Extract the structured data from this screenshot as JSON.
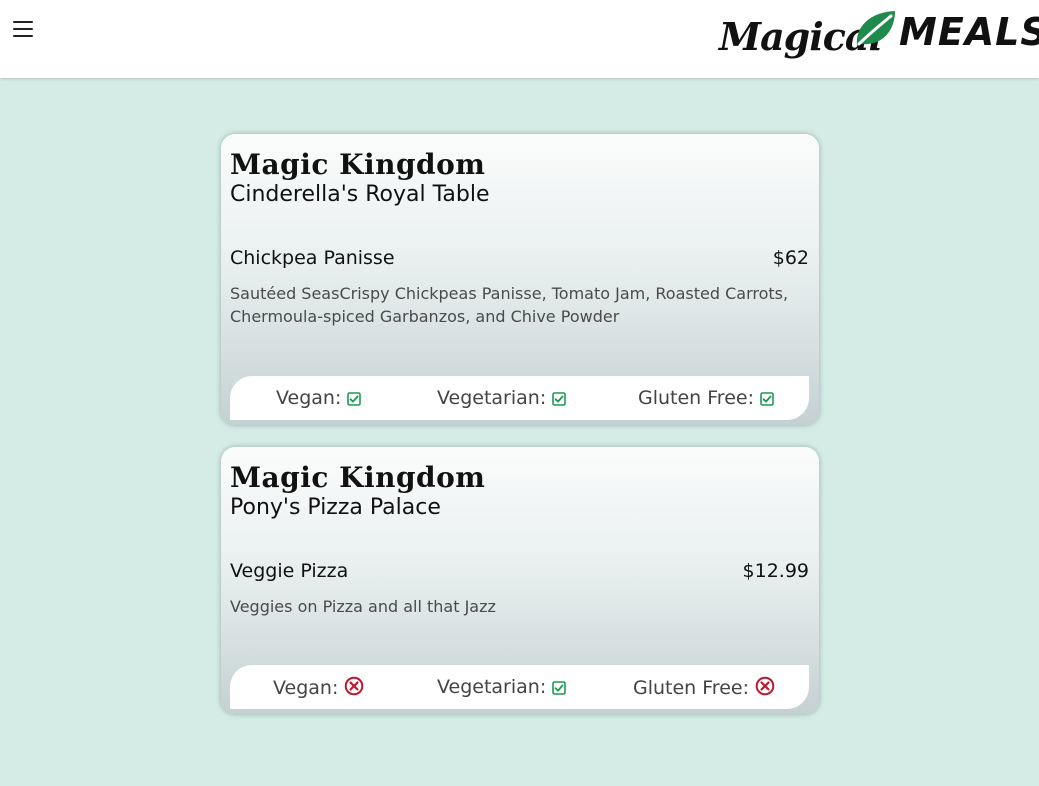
{
  "brand": {
    "logo_word_1": "Magical",
    "logo_word_2": "MEALS",
    "leaf_color": "#1f8a4c"
  },
  "colors": {
    "background": "#d5ece6",
    "check_color": "#1a9a52",
    "cross_color": "#c0162f"
  },
  "menu_icon": "hamburger-menu-icon",
  "cards": [
    {
      "park": "Magic Kingdom",
      "restaurant": "Cinderella's Royal Table",
      "dish": "Chickpea Panisse",
      "price": "$62",
      "description": "Sautéed SeasCrispy Chickpeas Panisse, Tomato Jam, Roasted Carrots, Chermoula-spiced Garbanzos, and Chive Powder",
      "diet": {
        "vegan_label": "Vegan:",
        "vegan": true,
        "vegetarian_label": "Vegetarian:",
        "vegetarian": true,
        "gluten_free_label": "Gluten Free:",
        "gluten_free": true
      }
    },
    {
      "park": "Magic Kingdom",
      "restaurant": "Pony's Pizza Palace",
      "dish": "Veggie Pizza",
      "price": "$12.99",
      "description": "Veggies on Pizza and all that Jazz",
      "diet": {
        "vegan_label": "Vegan:",
        "vegan": false,
        "vegetarian_label": "Vegetarian:",
        "vegetarian": true,
        "gluten_free_label": "Gluten Free:",
        "gluten_free": false
      }
    }
  ]
}
